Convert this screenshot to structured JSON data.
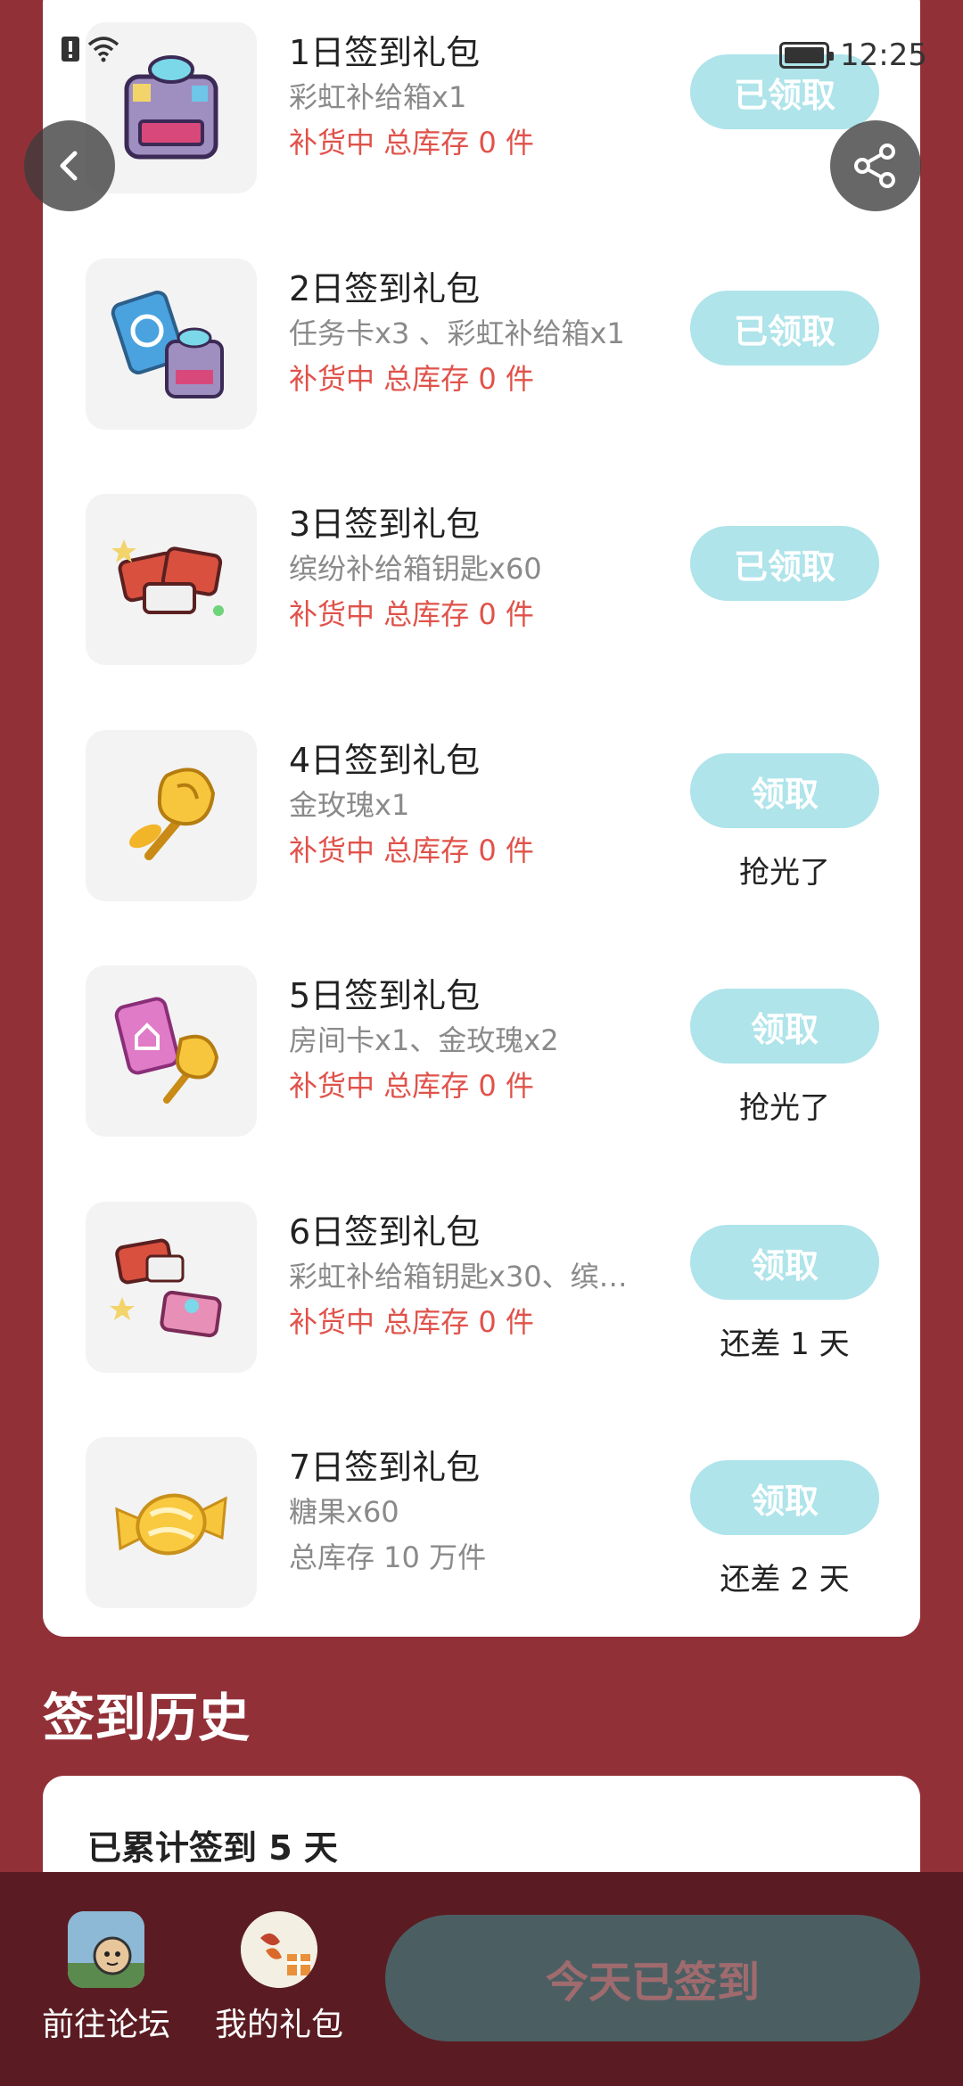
{
  "status_bar": {
    "time": "12:25"
  },
  "gift_packs": [
    {
      "title": "1日签到礼包",
      "desc": "彩虹补给箱x1",
      "stock": "补货中 总库存 0 件",
      "button": "已领取",
      "note": ""
    },
    {
      "title": "2日签到礼包",
      "desc": "任务卡x3 、彩虹补给箱x1",
      "stock": "补货中 总库存 0 件",
      "button": "已领取",
      "note": ""
    },
    {
      "title": "3日签到礼包",
      "desc": "缤纷补给箱钥匙x60",
      "stock": "补货中 总库存 0 件",
      "button": "已领取",
      "note": ""
    },
    {
      "title": "4日签到礼包",
      "desc": "金玫瑰x1",
      "stock": "补货中 总库存 0 件",
      "button": "领取",
      "note": "抢光了"
    },
    {
      "title": "5日签到礼包",
      "desc": "房间卡x1、金玫瑰x2",
      "stock": "补货中 总库存 0 件",
      "button": "领取",
      "note": "抢光了"
    },
    {
      "title": "6日签到礼包",
      "desc": "彩虹补给箱钥匙x30、缤…",
      "stock": "补货中 总库存 0 件",
      "button": "领取",
      "note": "还差 1 天"
    },
    {
      "title": "7日签到礼包",
      "desc": "糖果x60",
      "stock": "总库存 10 万件",
      "button": "领取",
      "note": "还差 2 天"
    }
  ],
  "history": {
    "title": "签到历史",
    "summary": "已累计签到 5 天"
  },
  "bottom_bar": {
    "forum_label": "前往论坛",
    "gifts_label": "我的礼包",
    "checkin_label": "今天已签到"
  },
  "icons": {
    "pack1": "rainbow-supply-box-icon",
    "pack2": "task-card-and-box-icon",
    "pack3": "supply-box-keys-icon",
    "pack4": "gold-rose-icon",
    "pack5": "room-card-and-roses-icon",
    "pack6": "keys-bundle-icon",
    "pack7": "candy-icon"
  },
  "colors": {
    "background": "#923038",
    "button": "#aee4ea",
    "stock_warning": "#e0524a",
    "bottom_bar": "#5a1c22",
    "checkin_button": "#4b5f63"
  }
}
